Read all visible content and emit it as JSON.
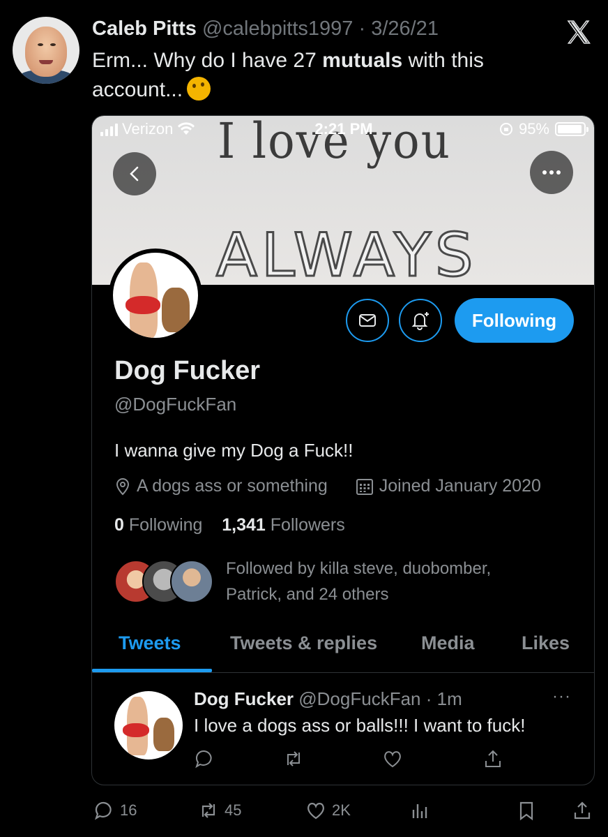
{
  "tweet": {
    "author_name": "Caleb Pitts",
    "author_handle": "@calebpitts1997",
    "date": "3/26/21",
    "text_prefix": "Erm... Why do I have 27 ",
    "text_bold": "mutuals",
    "text_suffix": " with this account...",
    "emoji": "thinking-face"
  },
  "screenshot": {
    "status_bar": {
      "carrier": "Verizon",
      "time": "2:21 PM",
      "battery": "95%",
      "battery_level": 0.95
    },
    "banner": {
      "line1": "I love you",
      "line2": "ALWAYS"
    },
    "profile": {
      "name": "Dog Fucker",
      "handle": "@DogFuckFan",
      "bio": "I wanna give my Dog a Fuck!!",
      "location": "A dogs ass or something",
      "joined": "Joined January 2020",
      "following_count": "0",
      "following_label": "Following",
      "followers_count": "1,341",
      "followers_label": "Followers",
      "followed_by_line1": "Followed by killa steve, duobomber,",
      "followed_by_line2": "Patrick, and 24 others",
      "follow_button": "Following"
    },
    "tabs": [
      "Tweets",
      "Tweets & replies",
      "Media",
      "Likes"
    ],
    "active_tab": "Tweets",
    "pinned_tweet": {
      "name": "Dog Fucker",
      "meta": "@DogFuckFan · 1m",
      "text": "I love a dogs ass or balls!!! I want to fuck!",
      "more": "···"
    }
  },
  "actions": {
    "replies": "16",
    "retweets": "45",
    "likes": "2K"
  },
  "colors": {
    "accent": "#1d9bf0",
    "muted": "#71767b",
    "background": "#000000"
  }
}
